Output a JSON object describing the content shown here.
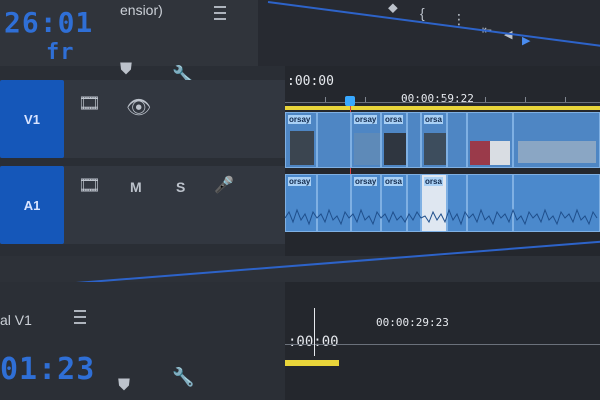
{
  "top": {
    "timecode": "26:01",
    "timecode2": "fr",
    "sequence_suffix": "ensior)",
    "icons": [
      "menu-icon",
      "marker-icon",
      "braces-icon",
      "more-icon",
      "step-back-icon",
      "play-icon"
    ]
  },
  "tracks": [
    {
      "id": "V1",
      "label": "V1"
    },
    {
      "id": "A1",
      "label": "A1"
    }
  ],
  "timeline": {
    "time_start": ":00:00",
    "time_mid": "00:00:59:22",
    "clip_label": "orsay",
    "clip_label_alt": "orsa"
  },
  "bottom": {
    "sequence_label": "al V1",
    "timecode": "01:23",
    "time_start": ":00:00",
    "time_mid": "00:00:29:23"
  },
  "colors": {
    "accent": "#1557b9",
    "timecode": "#2f6fd6",
    "clip": "#4e86c4",
    "yellow": "#e9d53a",
    "playhead": "#38a8ff"
  }
}
